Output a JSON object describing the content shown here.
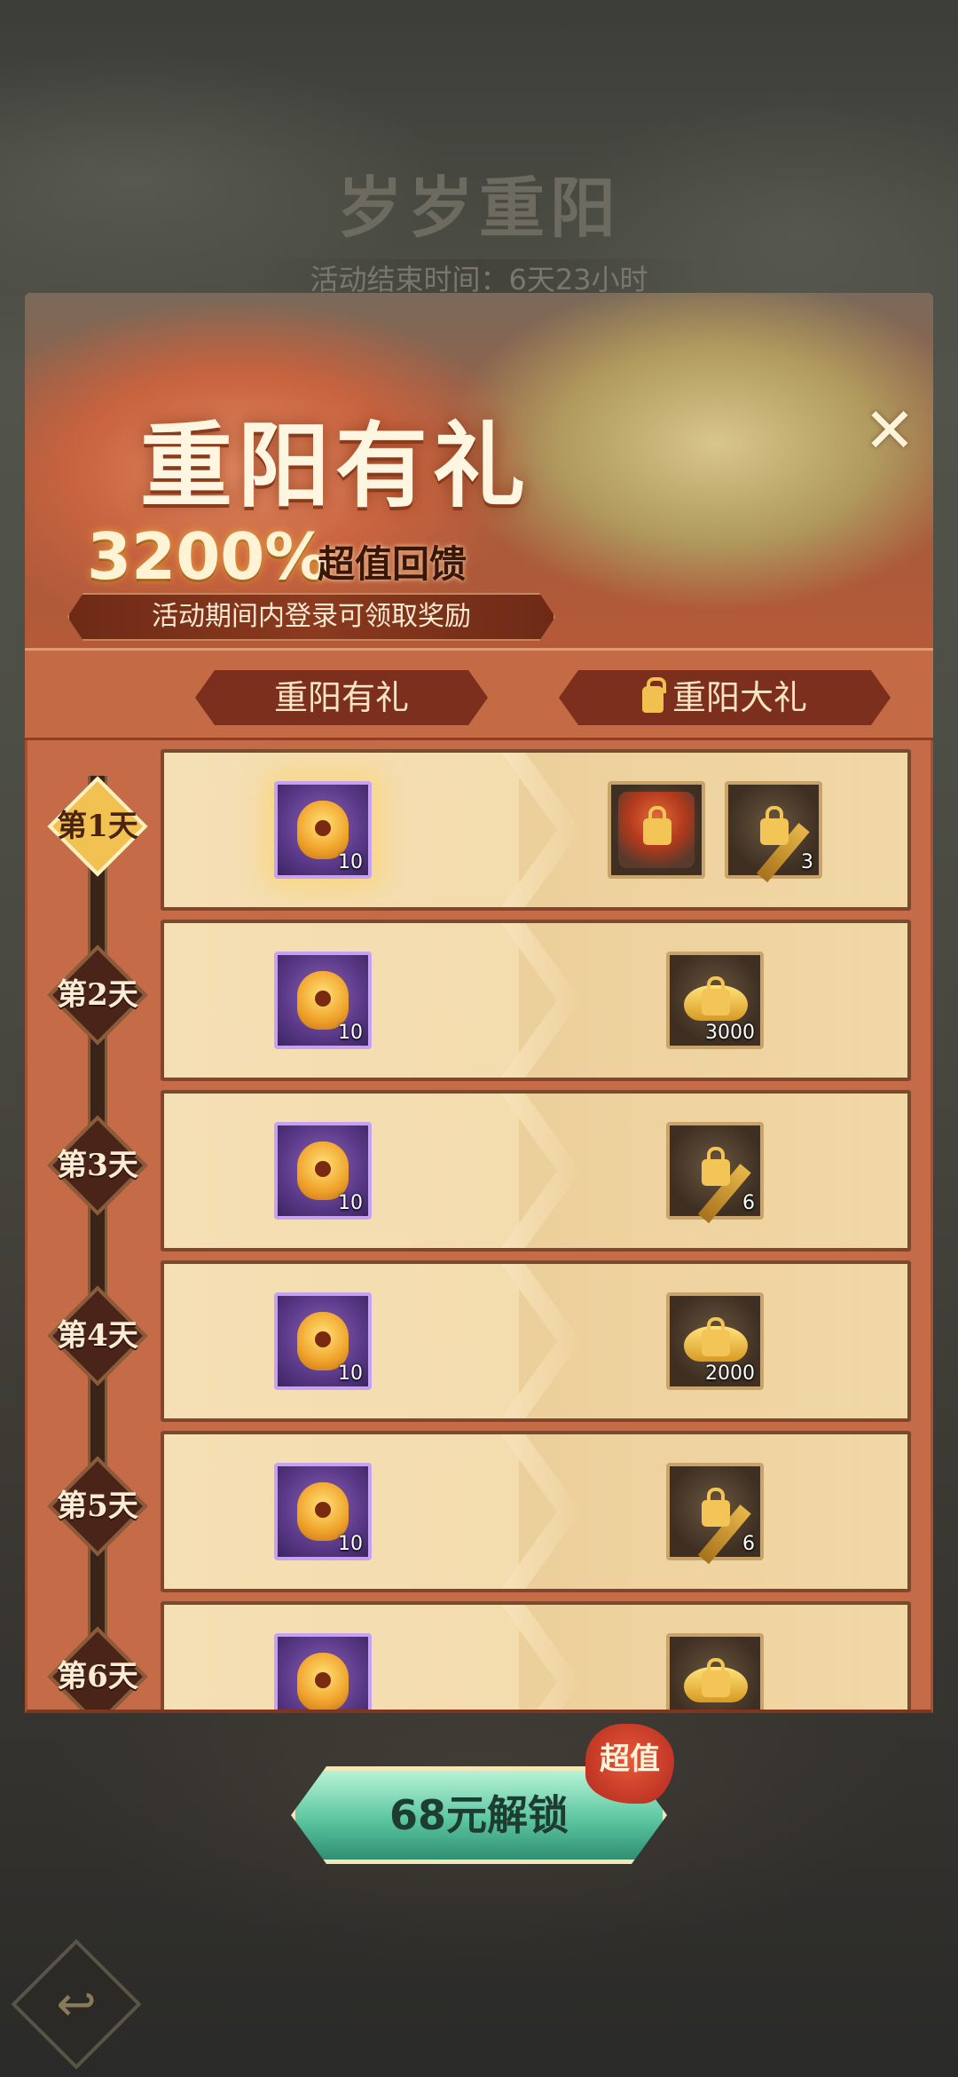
{
  "header": {
    "title": "岁岁重阳",
    "timer": "活动结束时间：6天23小时"
  },
  "banner": {
    "title": "重阳有礼",
    "percent": "3200%",
    "subtitle": "超值回馈",
    "note": "活动期间内登录可领取奖励",
    "close_icon": "close-icon"
  },
  "tabs": {
    "left": "重阳有礼",
    "right": "重阳大礼",
    "right_icon": "lock-icon"
  },
  "rows": [
    {
      "day": "第1天",
      "free": {
        "icon": "gold-shield-icon",
        "count": "10"
      },
      "premium": [
        {
          "icon": "hero-portrait-icon",
          "count": ""
        },
        {
          "icon": "key-icon",
          "count": "3"
        }
      ]
    },
    {
      "day": "第2天",
      "free": {
        "icon": "gold-shield-icon",
        "count": "10"
      },
      "premium": [
        {
          "icon": "gold-ingot-icon",
          "count": "3000"
        }
      ]
    },
    {
      "day": "第3天",
      "free": {
        "icon": "gold-shield-icon",
        "count": "10"
      },
      "premium": [
        {
          "icon": "key-icon",
          "count": "6"
        }
      ]
    },
    {
      "day": "第4天",
      "free": {
        "icon": "gold-shield-icon",
        "count": "10"
      },
      "premium": [
        {
          "icon": "gold-ingot-icon",
          "count": "2000"
        }
      ]
    },
    {
      "day": "第5天",
      "free": {
        "icon": "gold-shield-icon",
        "count": "10"
      },
      "premium": [
        {
          "icon": "key-icon",
          "count": "6"
        }
      ]
    },
    {
      "day": "第6天",
      "free": {
        "icon": "gold-shield-icon",
        "count": ""
      },
      "premium": [
        {
          "icon": "gold-ingot-icon",
          "count": ""
        }
      ]
    }
  ],
  "footer": {
    "unlock_label": "68元解锁",
    "value_tag": "超值",
    "back_icon": "back-arrow-icon"
  },
  "colors": {
    "panel_red": "#c56b47",
    "row_bg": "#f5dfb4",
    "button_green": "#5cc6a0"
  }
}
